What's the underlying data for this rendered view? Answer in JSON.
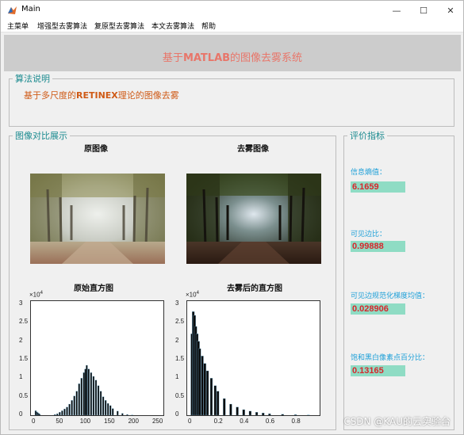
{
  "window": {
    "title": "Main",
    "controls": {
      "minimize": "—",
      "maximize": "☐",
      "close": "✕"
    }
  },
  "menu": [
    "主菜单",
    "增强型去雾算法",
    "复原型去雾算法",
    "本文去雾算法",
    "帮助"
  ],
  "header": {
    "title_prefix": "基于",
    "title_bold": "MATLAB",
    "title_suffix": "的图像去雾系统"
  },
  "algorithm": {
    "label": "算法说明",
    "desc_prefix": "基于多尺度的",
    "desc_bold": "RETINEX",
    "desc_suffix": "理论的图像去雾"
  },
  "comparison": {
    "label": "图像对比展示",
    "original_caption": "原图像",
    "dehazed_caption": "去雾图像",
    "orig_hist_caption": "原始直方图",
    "dehazed_hist_caption": "去雾后的直方图"
  },
  "metrics": {
    "label": "评价指标",
    "items": [
      {
        "label": "信息熵值：",
        "value": "6.1659"
      },
      {
        "label": "可见边比：",
        "value": "0.99888"
      },
      {
        "label": "可见边规范化梯度均值：",
        "value": "0.028906"
      },
      {
        "label": "饱和黑白像素点百分比：",
        "value": "0.13165"
      }
    ]
  },
  "watermark": "CSDN @KAU的云实验台",
  "colors": {
    "title": "#e8766a",
    "panel_label": "#1a8a8f",
    "metric_label": "#1ea0d8",
    "metric_value": "#d7262b",
    "metric_bg": "#8fdcc4"
  },
  "chart_data": [
    {
      "type": "bar",
      "title": "原始直方图",
      "exponent": "×10",
      "exponent_power": "4",
      "xlim": [
        0,
        255
      ],
      "ylim": [
        0,
        30000
      ],
      "xticks": [
        "0",
        "50",
        "100",
        "150",
        "200",
        "250"
      ],
      "yticks": [
        "0",
        "0.5",
        "1",
        "1.5",
        "2",
        "2.5",
        "3"
      ],
      "x": [
        0,
        2,
        4,
        6,
        8,
        40,
        45,
        50,
        55,
        60,
        65,
        70,
        75,
        80,
        85,
        90,
        95,
        100,
        103,
        106,
        110,
        115,
        120,
        125,
        130,
        135,
        140,
        145,
        150,
        155,
        160,
        170,
        180,
        190,
        200
      ],
      "values": [
        1200,
        900,
        700,
        500,
        300,
        200,
        400,
        800,
        1200,
        1700,
        2200,
        3000,
        4000,
        5200,
        6500,
        8500,
        10000,
        11500,
        12500,
        13500,
        12500,
        11500,
        10500,
        9500,
        8000,
        6500,
        5000,
        4000,
        3200,
        2600,
        1800,
        1100,
        500,
        200,
        80
      ]
    },
    {
      "type": "bar",
      "title": "去雾后的直方图",
      "exponent": "×10",
      "exponent_power": "4",
      "xlim": [
        0,
        0.95
      ],
      "ylim": [
        0,
        30000
      ],
      "xticks": [
        "0",
        "0.2",
        "0.4",
        "0.6",
        "0.8"
      ],
      "yticks": [
        "0",
        "0.5",
        "1",
        "1.5",
        "2",
        "2.5",
        "3"
      ],
      "x": [
        0,
        0.01,
        0.02,
        0.03,
        0.04,
        0.05,
        0.06,
        0.08,
        0.1,
        0.12,
        0.15,
        0.18,
        0.2,
        0.25,
        0.3,
        0.35,
        0.4,
        0.45,
        0.5,
        0.55,
        0.6,
        0.7,
        0.8,
        0.9
      ],
      "values": [
        22000,
        28000,
        27000,
        24000,
        22000,
        20000,
        18000,
        16000,
        14000,
        12000,
        10000,
        8000,
        6500,
        4500,
        3000,
        2200,
        1500,
        1100,
        800,
        600,
        400,
        250,
        150,
        80
      ]
    }
  ]
}
